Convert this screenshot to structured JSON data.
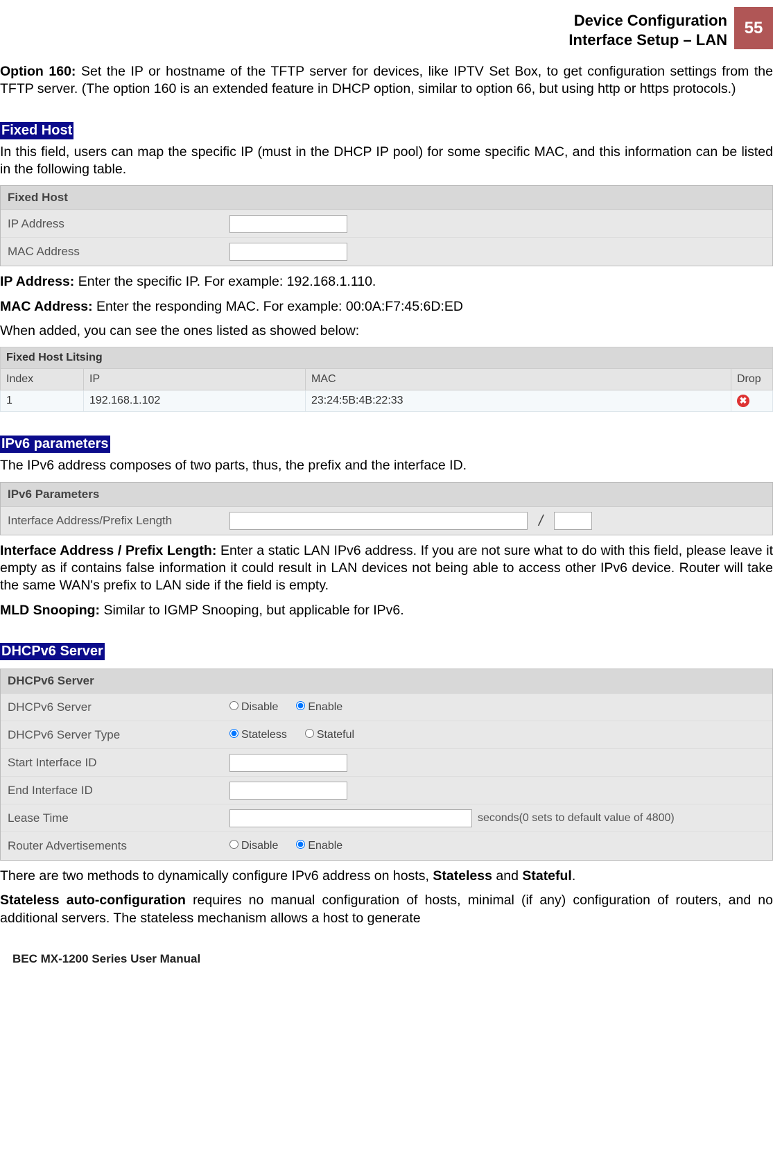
{
  "header": {
    "line1": "Device Configuration",
    "line2": "Interface Setup – LAN",
    "page": "55"
  },
  "option160": "Option 160: Set the IP or hostname of the TFTP server for devices, like IPTV Set Box, to get configuration settings from the TFTP server. (The option 160 is an extended feature in DHCP option, similar to option 66, but using http or https protocols.)",
  "fixedHost": {
    "title": "Fixed Host",
    "intro": "In this field, users can map the specific IP (must in the DHCP IP pool) for some specific MAC, and this information can be listed in the following table.",
    "panelTitle": "Fixed Host",
    "ipLabel": "IP Address",
    "macLabel": "MAC Address",
    "ipDescLead": "IP Address:",
    "ipDesc": " Enter the specific IP. For example: 192.168.1.110.",
    "macDescLead": "MAC Address:",
    "macDesc": " Enter the responding MAC. For example: 00:0A:F7:45:6D:ED",
    "addedNote": "When added, you can see the ones listed as showed below:"
  },
  "fixedListing": {
    "title": "Fixed Host Litsing",
    "cols": {
      "index": "Index",
      "ip": "IP",
      "mac": "MAC",
      "drop": "Drop"
    },
    "row": {
      "index": "1",
      "ip": "192.168.1.102",
      "mac": "23:24:5B:4B:22:33"
    }
  },
  "ipv6": {
    "title": "IPv6 parameters",
    "intro": "The IPv6 address composes of two parts, thus, the prefix and the interface ID.",
    "panelTitle": "IPv6 Parameters",
    "addrLabel": "Interface Address/Prefix Length",
    "ifaceDescLead": "Interface Address / Prefix Length:",
    "ifaceDesc": " Enter a static LAN IPv6 address. If you are not sure what to do with this field, please leave it empty as if contains false information it could result in LAN devices not being able to access other IPv6 device. Router will take the same WAN's prefix to LAN side if the field is empty.",
    "mldLead": "MLD Snooping:",
    "mldDesc": " Similar to IGMP Snooping, but applicable for IPv6."
  },
  "dhcpv6": {
    "title": "DHCPv6 Server",
    "panelTitle": "DHCPv6 Server",
    "serverLabel": "DHCPv6 Server",
    "disable": "Disable",
    "enable": "Enable",
    "typeLabel": "DHCPv6 Server Type",
    "stateless": "Stateless",
    "stateful": "Stateful",
    "startLabel": "Start Interface ID",
    "endLabel": "End Interface ID",
    "leaseLabel": "Lease Time",
    "leaseSuffix": "seconds(0 sets to default value of 4800)",
    "raLabel": "Router Advertisements",
    "desc1a": "There are two methods to dynamically configure IPv6 address on hosts, ",
    "desc1b": "Stateless",
    "desc1c": " and ",
    "desc1d": "Stateful",
    "desc1e": ".",
    "desc2lead": "Stateless auto-configuration",
    "desc2": " requires no manual configuration of hosts, minimal (if any) configuration of routers, and no additional servers. The stateless mechanism allows a host to generate"
  },
  "footer": "BEC MX-1200 Series User Manual"
}
